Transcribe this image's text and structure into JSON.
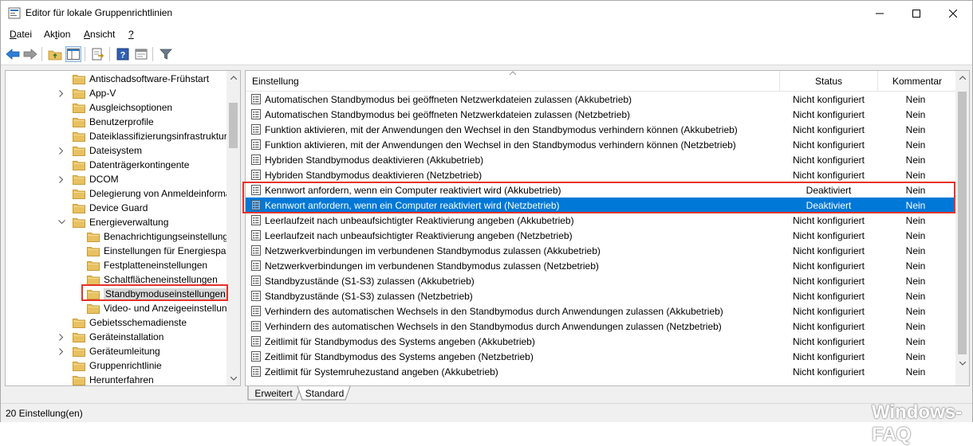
{
  "window": {
    "title": "Editor für lokale Gruppenrichtlinien"
  },
  "menu": [
    {
      "label_ul": "D",
      "label_rest": "atei"
    },
    {
      "label_pre": "Ak",
      "label_ul": "t",
      "label_rest": "ion"
    },
    {
      "label_ul": "A",
      "label_rest": "nsicht"
    },
    {
      "label_ul": "?",
      "label_rest": ""
    }
  ],
  "toolbar": {
    "icons": [
      "back-icon",
      "forward-icon",
      "up-folder-icon",
      "show-hide-tree-icon",
      "export-list-icon",
      "help-icon",
      "properties-icon",
      "filter-icon"
    ]
  },
  "tree": {
    "items": [
      {
        "label": "Antischadsoftware-Frühstart",
        "expandable": false,
        "level": 1
      },
      {
        "label": "App-V",
        "expandable": true,
        "level": 1
      },
      {
        "label": "Ausgleichsoptionen",
        "expandable": false,
        "level": 1
      },
      {
        "label": "Benutzerprofile",
        "expandable": false,
        "level": 1
      },
      {
        "label": "Dateiklassifizierungsinfrastruktur",
        "expandable": false,
        "level": 1
      },
      {
        "label": "Dateisystem",
        "expandable": true,
        "level": 1
      },
      {
        "label": "Datenträgerkontingente",
        "expandable": false,
        "level": 1
      },
      {
        "label": "DCOM",
        "expandable": true,
        "level": 1
      },
      {
        "label": "Delegierung von Anmeldeinforma",
        "expandable": false,
        "level": 1
      },
      {
        "label": "Device Guard",
        "expandable": false,
        "level": 1
      },
      {
        "label": "Energieverwaltung",
        "expandable": true,
        "expanded": true,
        "level": 1
      },
      {
        "label": "Benachrichtigungseinstellung",
        "expandable": false,
        "level": 2
      },
      {
        "label": "Einstellungen für Energiesparr",
        "expandable": false,
        "level": 2
      },
      {
        "label": "Festplatteneinstellungen",
        "expandable": false,
        "level": 2
      },
      {
        "label": "Schaltflächeneinstellungen",
        "expandable": false,
        "level": 2
      },
      {
        "label": "Standbymoduseinstellungen",
        "expandable": false,
        "level": 2,
        "selected": true
      },
      {
        "label": "Video- und Anzeigeeinstellung",
        "expandable": false,
        "level": 2
      },
      {
        "label": "Gebietsschemadienste",
        "expandable": false,
        "level": 1
      },
      {
        "label": "Geräteinstallation",
        "expandable": true,
        "level": 1
      },
      {
        "label": "Geräteumleitung",
        "expandable": true,
        "level": 1
      },
      {
        "label": "Gruppenrichtlinie",
        "expandable": false,
        "level": 1
      },
      {
        "label": "Herunterfahren",
        "expandable": false,
        "level": 1
      }
    ]
  },
  "list": {
    "columns": {
      "setting": "Einstellung",
      "status": "Status",
      "comment": "Kommentar"
    },
    "rows": [
      {
        "name": "Automatischen Standbymodus bei geöffneten Netzwerkdateien zulassen (Akkubetrieb)",
        "status": "Nicht konfiguriert",
        "comment": "Nein"
      },
      {
        "name": "Automatischen Standbymodus bei geöffneten Netzwerkdateien zulassen (Netzbetrieb)",
        "status": "Nicht konfiguriert",
        "comment": "Nein"
      },
      {
        "name": "Funktion aktivieren, mit der Anwendungen den Wechsel in den Standbymodus verhindern können (Akkubetrieb)",
        "status": "Nicht konfiguriert",
        "comment": "Nein"
      },
      {
        "name": "Funktion aktivieren, mit der Anwendungen den Wechsel in den Standbymodus verhindern können (Netzbetrieb)",
        "status": "Nicht konfiguriert",
        "comment": "Nein"
      },
      {
        "name": "Hybriden Standbymodus deaktivieren (Akkubetrieb)",
        "status": "Nicht konfiguriert",
        "comment": "Nein"
      },
      {
        "name": "Hybriden Standbymodus deaktivieren (Netzbetrieb)",
        "status": "Nicht konfiguriert",
        "comment": "Nein"
      },
      {
        "name": "Kennwort anfordern, wenn ein Computer reaktiviert wird (Akkubetrieb)",
        "status": "Deaktiviert",
        "comment": "Nein"
      },
      {
        "name": "Kennwort anfordern, wenn ein Computer reaktiviert wird (Netzbetrieb)",
        "status": "Deaktiviert",
        "comment": "Nein",
        "selected": true
      },
      {
        "name": "Leerlaufzeit nach unbeaufsichtigter Reaktivierung angeben (Akkubetrieb)",
        "status": "Nicht konfiguriert",
        "comment": "Nein"
      },
      {
        "name": "Leerlaufzeit nach unbeaufsichtigter Reaktivierung angeben (Netzbetrieb)",
        "status": "Nicht konfiguriert",
        "comment": "Nein"
      },
      {
        "name": "Netzwerkverbindungen im verbundenen Standbymodus zulassen (Akkubetrieb)",
        "status": "Nicht konfiguriert",
        "comment": "Nein"
      },
      {
        "name": "Netzwerkverbindungen im verbundenen Standbymodus zulassen (Netzbetrieb)",
        "status": "Nicht konfiguriert",
        "comment": "Nein"
      },
      {
        "name": "Standbyzustände (S1-S3) zulassen (Akkubetrieb)",
        "status": "Nicht konfiguriert",
        "comment": "Nein"
      },
      {
        "name": "Standbyzustände (S1-S3) zulassen (Netzbetrieb)",
        "status": "Nicht konfiguriert",
        "comment": "Nein"
      },
      {
        "name": "Verhindern des automatischen Wechsels in den Standbymodus durch Anwendungen zulassen (Akkubetrieb)",
        "status": "Nicht konfiguriert",
        "comment": "Nein"
      },
      {
        "name": "Verhindern des automatischen Wechsels in den Standbymodus durch Anwendungen zulassen (Netzbetrieb)",
        "status": "Nicht konfiguriert",
        "comment": "Nein"
      },
      {
        "name": "Zeitlimit für Standbymodus des Systems angeben (Akkubetrieb)",
        "status": "Nicht konfiguriert",
        "comment": "Nein"
      },
      {
        "name": "Zeitlimit für Standbymodus des Systems angeben (Netzbetrieb)",
        "status": "Nicht konfiguriert",
        "comment": "Nein"
      },
      {
        "name": "Zeitlimit für Systemruhezustand angeben (Akkubetrieb)",
        "status": "Nicht konfiguriert",
        "comment": "Nein"
      }
    ]
  },
  "tabs": [
    {
      "label": "Erweitert"
    },
    {
      "label": "Standard",
      "active": true
    }
  ],
  "statusbar": {
    "text": "20 Einstellung(en)"
  },
  "watermark": "Windows-FAQ",
  "colors": {
    "selection": "#0078d7",
    "highlight_box": "#e5332a",
    "folder": "#e8c160"
  }
}
